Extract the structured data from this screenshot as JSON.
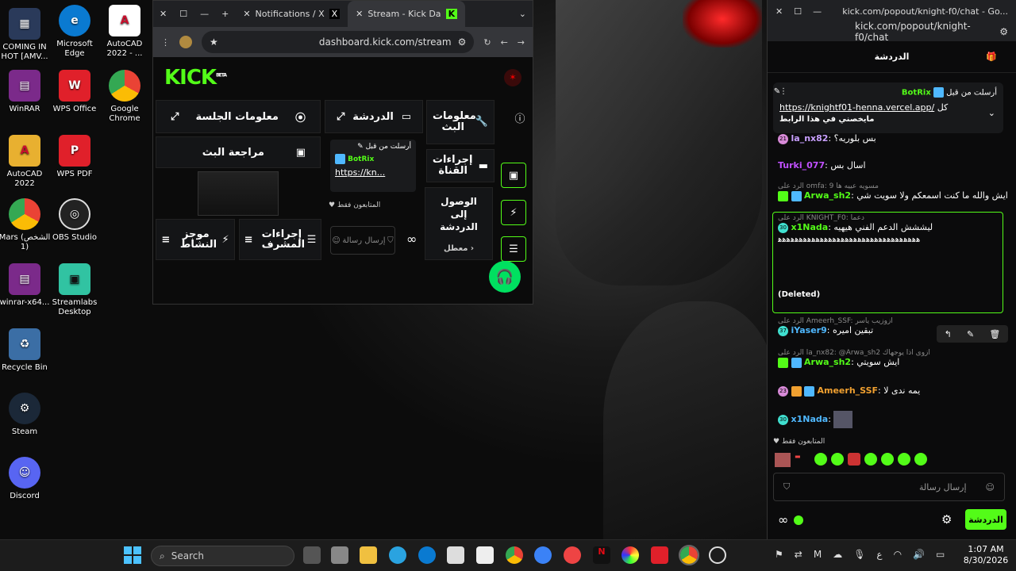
{
  "desktop": {
    "icons": [
      {
        "label": "COMING IN HOT [AMV...",
        "color": "#2a3a5a",
        "glyph": "▦"
      },
      {
        "label": "Microsoft Edge",
        "color": "#0a7ad1",
        "glyph": "e"
      },
      {
        "label": "AutoCAD 2022 - ...",
        "color": "#c8102e",
        "glyph": "A"
      },
      {
        "label": "WinRAR",
        "color": "#7b2a8a",
        "glyph": "▤"
      },
      {
        "label": "WPS Office",
        "color": "#e0202a",
        "glyph": "W"
      },
      {
        "label": "Google Chrome",
        "color": "#3a8f3a",
        "glyph": "◉"
      },
      {
        "label": "AutoCAD 2022",
        "color": "#e8b030",
        "glyph": "A"
      },
      {
        "label": "WPS PDF",
        "color": "#e0202a",
        "glyph": "P"
      },
      {
        "label": "Mars (الشخص 1)",
        "color": "#3a8f3a",
        "glyph": "◉"
      },
      {
        "label": "OBS Studio",
        "color": "#222",
        "glyph": "◎"
      },
      {
        "label": "winrar-x64...",
        "color": "#7b2a8a",
        "glyph": "▤"
      },
      {
        "label": "Streamlabs Desktop",
        "color": "#31c3a2",
        "glyph": "▣"
      },
      {
        "label": "Recycle Bin",
        "color": "#3b6ea5",
        "glyph": "♻"
      },
      {
        "label": "Steam",
        "color": "#1b2838",
        "glyph": "⚙"
      },
      {
        "label": "Discord",
        "color": "#5865f2",
        "glyph": "☺"
      }
    ]
  },
  "browser1": {
    "tabs": [
      {
        "label": "Notifications / X"
      },
      {
        "label": "Stream - Kick Da"
      }
    ],
    "url": "dashboard.kick.com/stream",
    "logo": "KICK",
    "logo_sup": "BETA",
    "panels": {
      "session_info": "معلومات الجلسة",
      "chat": "الدردشة",
      "stream_info": "معلومات البث",
      "stream_review": "مراجعة البث",
      "channel_actions": "إجراءات القناة",
      "chat_access": "الوصول إلى الدردشة",
      "disabled": "معطل",
      "activity_feed": "موجز النشاط",
      "mod_actions": "إجراءات المشرف",
      "pinned_sent": "أرسلت من قبل",
      "pinned_user": "BotRix",
      "pinned_link": "https://kn...",
      "followers_only": "المتابعون فقط",
      "send_message": "إرسال رسالة"
    }
  },
  "browser2": {
    "title": "kick.com/popout/knight-f0/chat - Go...",
    "url": "kick.com/popout/knight-f0/chat",
    "chat_title": "الدردشة",
    "pinned": {
      "sent_by": "أرسلت من قبل",
      "user": "BotRix",
      "link": "https://knightf01-henna.vercel.app/",
      "link_suffix": "كل",
      "line2": "مايخصني في هذا الرابط"
    },
    "messages": [
      {
        "user": "la_nx82",
        "text": "بس بلوريه؟",
        "color": "#c9a0ff",
        "badge": "21",
        "bcol": "#d88ad8"
      },
      {
        "user": "Turki_077",
        "text": "اسال بس",
        "color": "#c050ff"
      },
      {
        "reply": "الرد على omfa: مسويه عييه ها 9",
        "user": "Arwa_sh2",
        "text": "ايش والله ما كنت اسمعكم ولا سويت شي",
        "color": "#53fc18"
      },
      {
        "reply": "الرد على KNIGHT_F0: دعما",
        "user": "x1Nada",
        "text": "ليششش الدعم الفني هيهيه",
        "color": "#53fc18",
        "badge": "30",
        "bcol": "#40e0d0",
        "cont": "ﻫﻫﻫﻫﻫﻫﻫﻫﻫﻫﻫﻫﻫﻫﻫﻫﻫﻫﻫﻫﻫﻫﻫﻫﻫﻫﻫﻫﻫﻫﻫﻫﻫﻫ",
        "deleted": "(Deleted)"
      },
      {
        "reply": "الرد على Ameerh_SSF: ازوزيب ياسر",
        "user": "iYaser9",
        "text": "تبقين اميره",
        "color": "#4fb8ff",
        "badge": "37",
        "bcol": "#40e0d0"
      },
      {
        "reply": "الرد على la_nx82: @Arwa_sh2 ازوى اذا يوجهاك",
        "user": "Arwa_sh2",
        "text": "ايش سويتي",
        "color": "#53fc18"
      },
      {
        "user": "Ameerh_SSF",
        "text": "يمه ندى لا",
        "color": "#f0a030",
        "badge": "23",
        "bcol": "#d88ad8"
      },
      {
        "user": "x1Nada",
        "text": "",
        "color": "#4fb8ff",
        "badge": "30",
        "bcol": "#40e0d0"
      }
    ],
    "followers_only": "المتابعون فقط",
    "input_placeholder": "إرسال رسالة",
    "chat_button": "الدردشة"
  },
  "taskbar": {
    "search": "Search",
    "time": "1:07 AM",
    "date": "8/30/2026",
    "lang": "ع"
  }
}
